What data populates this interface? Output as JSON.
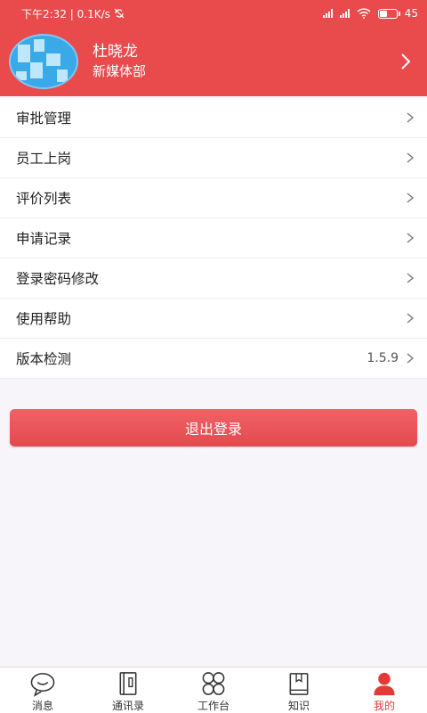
{
  "status_bar": {
    "time_speed": "下午2:32 | 0.1K/s",
    "battery": "45",
    "battery_level": 0.45
  },
  "profile": {
    "name": "杜晓龙",
    "department": "新媒体部"
  },
  "menu": {
    "items": [
      {
        "label": "审批管理"
      },
      {
        "label": "员工上岗"
      },
      {
        "label": "评价列表"
      },
      {
        "label": "申请记录"
      },
      {
        "label": "登录密码修改"
      },
      {
        "label": "使用帮助"
      },
      {
        "label": "版本检测",
        "value": "1.5.9"
      }
    ]
  },
  "logout_label": "退出登录",
  "tabs": [
    {
      "label": "消息",
      "icon": "chat-icon"
    },
    {
      "label": "通讯录",
      "icon": "contacts-book-icon"
    },
    {
      "label": "工作台",
      "icon": "workbench-grid-icon"
    },
    {
      "label": "知识",
      "icon": "knowledge-book-icon"
    },
    {
      "label": "我的",
      "icon": "user-icon",
      "active": true
    }
  ],
  "colors": {
    "brand": "#e94a4c",
    "active_tab": "#e53935"
  }
}
